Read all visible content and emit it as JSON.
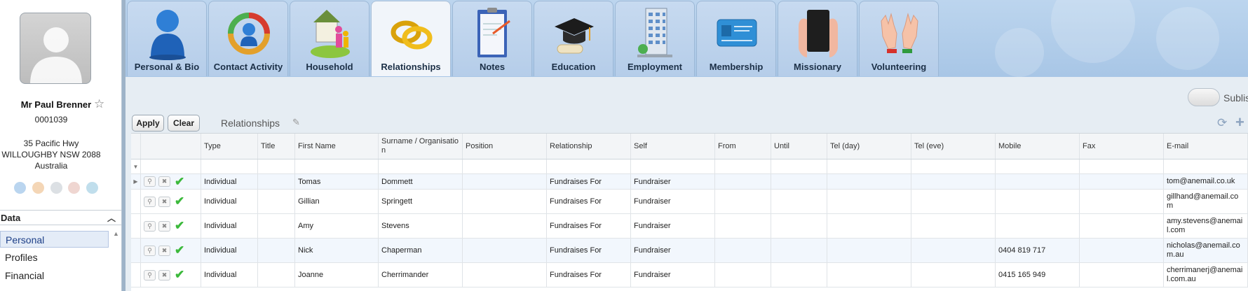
{
  "person": {
    "name": "Mr Paul Brenner",
    "id": "0001039",
    "address_line1": "35 Pacific Hwy",
    "address_line2": "WILLOUGHBY NSW 2088",
    "address_line3": "Australia"
  },
  "nav": {
    "section_title": "Data",
    "items": [
      {
        "label": "Personal",
        "selected": true
      },
      {
        "label": "Profiles",
        "selected": false
      },
      {
        "label": "Financial",
        "selected": false
      }
    ]
  },
  "tabs": [
    {
      "label": "Personal & Bio",
      "icon": "person-icon",
      "active": false
    },
    {
      "label": "Contact Activity",
      "icon": "contact-activity-icon",
      "active": false
    },
    {
      "label": "Household",
      "icon": "household-icon",
      "active": false
    },
    {
      "label": "Relationships",
      "icon": "rings-icon",
      "active": true
    },
    {
      "label": "Notes",
      "icon": "notes-icon",
      "active": false
    },
    {
      "label": "Education",
      "icon": "graduation-cap-icon",
      "active": false
    },
    {
      "label": "Employment",
      "icon": "office-building-icon",
      "active": false
    },
    {
      "label": "Membership",
      "icon": "membership-card-icon",
      "active": false
    },
    {
      "label": "Missionary",
      "icon": "bible-icon",
      "active": false
    },
    {
      "label": "Volunteering",
      "icon": "hands-icon",
      "active": false
    }
  ],
  "toolbar": {
    "apply_label": "Apply",
    "clear_label": "Clear",
    "title": "Relationships",
    "sublist_label": "Sublis"
  },
  "grid": {
    "columns": [
      "",
      "",
      "Type",
      "Title",
      "First Name",
      "Surname / Organisation",
      "Position",
      "Relationship",
      "Self",
      "From",
      "Until",
      "Tel (day)",
      "Tel (eve)",
      "Mobile",
      "Fax",
      "E-mail"
    ],
    "rows": [
      {
        "type": "Individual",
        "title": "",
        "first_name": "Tomas",
        "surname": "Dommett",
        "position": "",
        "relationship": "Fundraises For",
        "self": "Fundraiser",
        "from": "",
        "until": "",
        "tel_day": "",
        "tel_eve": "",
        "mobile": "",
        "fax": "",
        "email": "tom@anemail.co.uk"
      },
      {
        "type": "Individual",
        "title": "",
        "first_name": "Gillian",
        "surname": "Springett",
        "position": "",
        "relationship": "Fundraises For",
        "self": "Fundraiser",
        "from": "",
        "until": "",
        "tel_day": "",
        "tel_eve": "",
        "mobile": "",
        "fax": "",
        "email": "gillhand@anemail.com"
      },
      {
        "type": "Individual",
        "title": "",
        "first_name": "Amy",
        "surname": "Stevens",
        "position": "",
        "relationship": "Fundraises For",
        "self": "Fundraiser",
        "from": "",
        "until": "",
        "tel_day": "",
        "tel_eve": "",
        "mobile": "",
        "fax": "",
        "email": "amy.stevens@anemail.com"
      },
      {
        "type": "Individual",
        "title": "",
        "first_name": "Nick",
        "surname": "Chaperman",
        "position": "",
        "relationship": "Fundraises For",
        "self": "Fundraiser",
        "from": "",
        "until": "",
        "tel_day": "",
        "tel_eve": "",
        "mobile": "0404 819 717",
        "fax": "",
        "email": "nicholas@anemail.com.au"
      },
      {
        "type": "Individual",
        "title": "",
        "first_name": "Joanne",
        "surname": "Cherrimander",
        "position": "",
        "relationship": "Fundraises For",
        "self": "Fundraiser",
        "from": "",
        "until": "",
        "tel_day": "",
        "tel_eve": "",
        "mobile": "0415 165 949",
        "fax": "",
        "email": "cherrimanerj@anemail.com.au"
      }
    ]
  },
  "colors": {
    "accent": "#1d3f87",
    "tab_bar": "#b5cde9",
    "check_green": "#3cb93c"
  }
}
